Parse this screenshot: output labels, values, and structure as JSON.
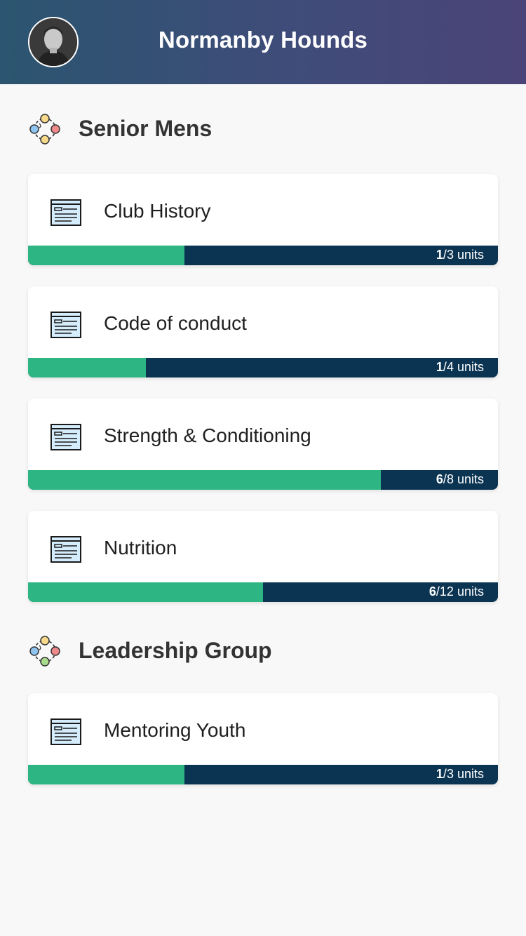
{
  "header": {
    "title": "Normanby Hounds",
    "avatar_alt": "user-avatar"
  },
  "sections": [
    {
      "title": "Senior Mens",
      "icon": "group-icon",
      "courses": [
        {
          "title": "Club History",
          "completed": "1",
          "total": "3",
          "unit_label": "units",
          "progress": 0.333,
          "icon": "document-icon"
        },
        {
          "title": "Code of conduct",
          "completed": "1",
          "total": "4",
          "unit_label": "units",
          "progress": 0.25,
          "icon": "document-icon"
        },
        {
          "title": "Strength & Conditioning",
          "completed": "6",
          "total": "8",
          "unit_label": "units",
          "progress": 0.75,
          "icon": "document-icon"
        },
        {
          "title": "Nutrition",
          "completed": "6",
          "total": "12",
          "unit_label": "units",
          "progress": 0.5,
          "icon": "document-icon"
        }
      ]
    },
    {
      "title": "Leadership Group",
      "icon": "group-icon",
      "courses": [
        {
          "title": "Mentoring Youth",
          "completed": "1",
          "total": "3",
          "unit_label": "units",
          "progress": 0.333,
          "icon": "document-icon"
        }
      ]
    }
  ],
  "colors": {
    "progress_fill": "#2db584",
    "progress_track": "#0b3452",
    "header_start": "#2b5570",
    "header_end": "#4b4479"
  }
}
